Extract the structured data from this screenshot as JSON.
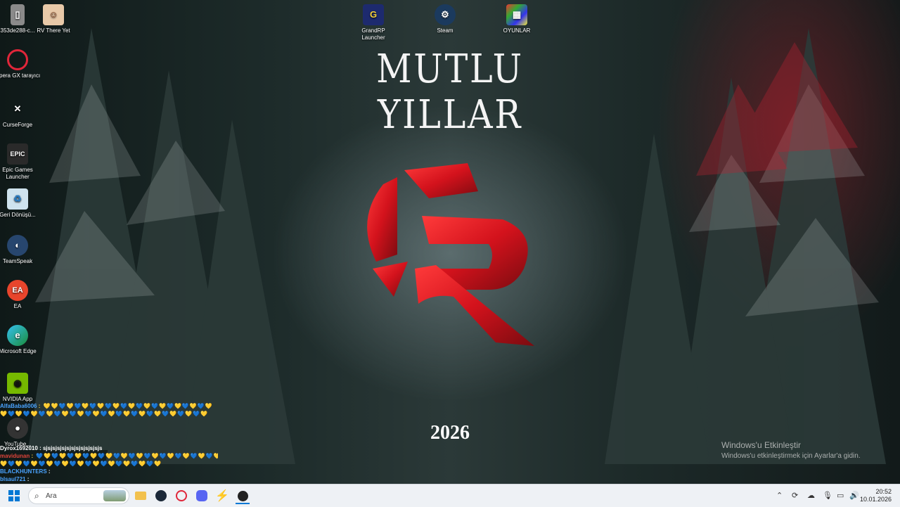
{
  "desktop_icons": {
    "left_column": [
      {
        "label": "353de288-c...",
        "icon": "file-icon"
      },
      {
        "label": "RV There Yet",
        "icon": "game-icon"
      },
      {
        "label": "Opera GX tarayıcı",
        "icon": "opera-gx-icon"
      },
      {
        "label": "CurseForge",
        "icon": "curseforge-icon"
      },
      {
        "label": "Epic Games Launcher",
        "icon": "epic-games-icon"
      },
      {
        "label": "Geri Dönüşü...",
        "icon": "recycle-bin-icon"
      },
      {
        "label": "TeamSpeak",
        "icon": "teamspeak-icon"
      },
      {
        "label": "EA",
        "icon": "ea-icon"
      },
      {
        "label": "Microsoft Edge",
        "icon": "edge-icon"
      },
      {
        "label": "NVIDIA App",
        "icon": "nvidia-icon"
      },
      {
        "label": "YouTube...",
        "icon": "obs-icon"
      }
    ],
    "top_row": [
      {
        "label": "GrandRP Launcher",
        "icon": "grandrp-icon"
      },
      {
        "label": "Steam",
        "icon": "steam-icon"
      },
      {
        "label": "OYUNLAR",
        "icon": "folder-games-icon"
      }
    ]
  },
  "wallpaper": {
    "title": "MUTLU YILLAR",
    "year": "2026",
    "brand_color": "#d3121c"
  },
  "activation": {
    "title": "Windows'u Etkinleştir",
    "subtitle": "Windows'u etkinleştirmek için Ayarlar'a gidin."
  },
  "chat": [
    {
      "user": "AlfaBaba6006",
      "color": "#4aa3ff",
      "text": ": 💛💛💙💛💙💛💙💛💙💛💙💛💙💛💙💛💙💛💙💛💙💛"
    },
    {
      "user": "",
      "color": "#f5d23a",
      "text": "💛💙💛💙💛💙💛💙💛💙💛💙💛💙💛💙💛💙💛💙💛💙💛💙💛💙💛"
    },
    {
      "user": "Dyrox1692010",
      "color": "#ffffff",
      "text": ": sjsjsjsjsjsjsjsjsjsjsjsjs"
    },
    {
      "user": "mavidunan",
      "color": "#e0443a",
      "text": ": 💙💛💙💛💙💛💙💛💙💛💙💛💙💛💙💛💙💛💙💛💙💛💙💛💙"
    },
    {
      "user": "",
      "color": "#f5d23a",
      "text": "💛💙💛💙💛💙💛💙💛💙💛💙💛💙💛💙💛💙💛💙💛"
    },
    {
      "user": "BLACKHUNTERS",
      "color": "#4aa3ff",
      "text": ":"
    },
    {
      "user": "blsaul721",
      "color": "#4aa3ff",
      "text": ":"
    }
  ],
  "taskbar": {
    "search_placeholder": "Ara",
    "pinned": [
      "start-icon",
      "search-icon",
      "file-explorer-icon",
      "steam-icon",
      "opera-gx-icon",
      "discord-icon",
      "app-bolt-icon",
      "obs-icon"
    ],
    "time": "20:52",
    "date": "10.01.2026"
  }
}
